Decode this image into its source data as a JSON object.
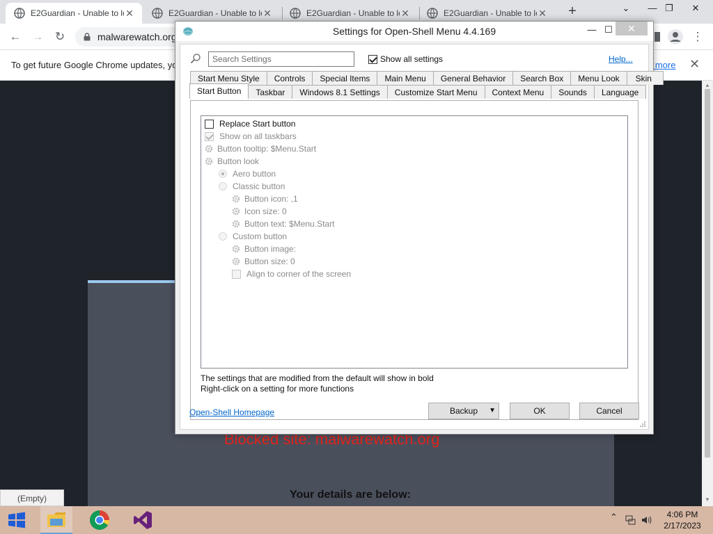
{
  "browser": {
    "tabs": [
      {
        "title": "E2Guardian - Unable to lo",
        "active": true
      },
      {
        "title": "E2Guardian - Unable to lo",
        "active": false
      },
      {
        "title": "E2Guardian - Unable to lo",
        "active": false
      },
      {
        "title": "E2Guardian - Unable to lo",
        "active": false
      }
    ],
    "new_tab_label": "+",
    "window_controls": {
      "dropdown": "⌄",
      "minimize": "—",
      "restore": "❐",
      "close": "✕"
    },
    "address": "malwarewatch.org",
    "infobar": {
      "text": "To get future Google Chrome updates, yo",
      "link": "n more",
      "close": "✕"
    }
  },
  "page": {
    "blocked_text": "Blocked site: malwarewatch.org",
    "details_text": "Your details are below:",
    "tooltip": "(Empty)"
  },
  "dialog": {
    "title": "Settings for Open-Shell Menu 4.4.169",
    "minimize": "—",
    "maximize": "☐",
    "close": "✕",
    "search_placeholder": "Search Settings",
    "show_all_label": "Show all settings",
    "show_all_checked": true,
    "help_label": "Help...",
    "tabs_row1": [
      "Start Menu Style",
      "Controls",
      "Special Items",
      "Main Menu",
      "General Behavior",
      "Search Box",
      "Menu Look",
      "Skin"
    ],
    "tabs_row2": [
      "Start Button",
      "Taskbar",
      "Windows 8.1 Settings",
      "Customize Start Menu",
      "Context Menu",
      "Sounds",
      "Language"
    ],
    "active_tab": "Start Button",
    "settings": {
      "replace_start": "Replace Start button",
      "show_all_taskbars": "Show on all taskbars",
      "button_tooltip": "Button tooltip: $Menu.Start",
      "button_look": "Button look",
      "aero_button": "Aero button",
      "classic_button": "Classic button",
      "button_icon": "Button icon: ,1",
      "icon_size": "Icon size: 0",
      "button_text": "Button text: $Menu.Start",
      "custom_button": "Custom button",
      "button_image": "Button image:",
      "button_size": "Button size: 0",
      "align_corner": "Align to corner of the screen"
    },
    "note_bold": "The settings that are modified from the default will show in bold",
    "note_rightclick": "Right-click on a setting for more functions",
    "homepage_link": "Open-Shell Homepage",
    "backup_label": "Backup",
    "ok_label": "OK",
    "cancel_label": "Cancel"
  },
  "taskbar": {
    "time": "4:06 PM",
    "date": "2/17/2023",
    "tray_chevron": "⌃"
  },
  "colors": {
    "chrome_tabbar": "#dfe1e5",
    "taskbar": "#d7b8a5",
    "blocked_red": "#e2241c",
    "link_blue": "#0066cc"
  }
}
